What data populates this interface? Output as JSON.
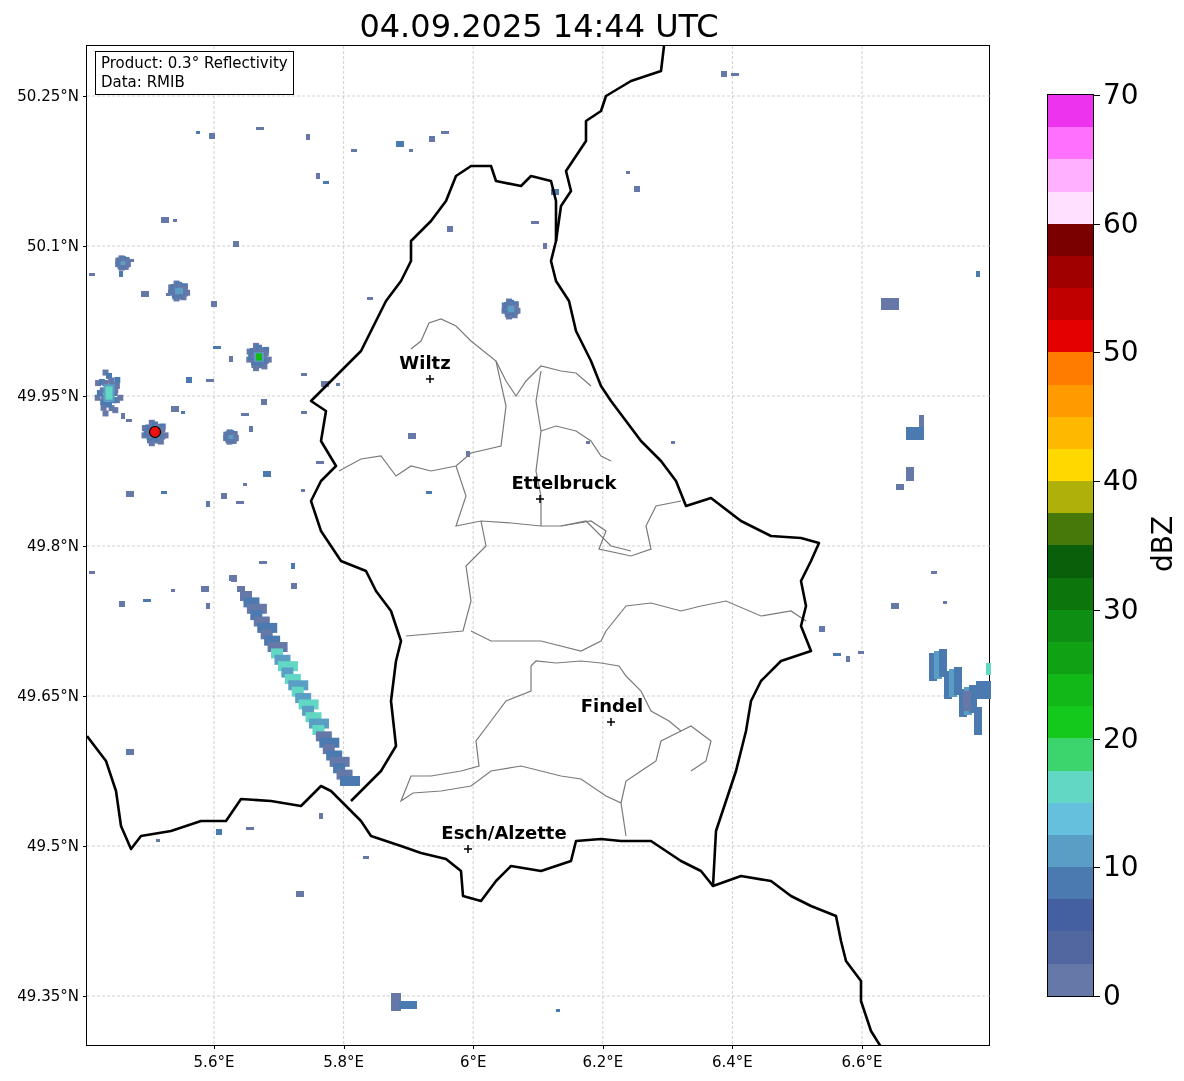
{
  "title": "04.09.2025 14:44 UTC",
  "map": {
    "info_box": [
      "Product: 0.3° Reflectivity",
      "Data: RMIB"
    ],
    "yticks": [
      "50.25°N",
      "50.1°N",
      "49.95°N",
      "49.8°N",
      "49.65°N",
      "49.5°N",
      "49.35°N"
    ],
    "xticks": [
      "5.6°E",
      "5.8°E",
      "6°E",
      "6.2°E",
      "6.4°E",
      "6.6°E"
    ],
    "cities": [
      {
        "name": "Wiltz"
      },
      {
        "name": "Ettelbruck"
      },
      {
        "name": "Findel"
      },
      {
        "name": "Esch/Alzette"
      }
    ]
  },
  "colorbar": {
    "label": "dBZ",
    "ticks": [
      "70",
      "60",
      "50",
      "40",
      "30",
      "20",
      "10",
      "0"
    ],
    "bands": [
      {
        "color": "#ee33ee"
      },
      {
        "color": "#ff70ff"
      },
      {
        "color": "#ffb0ff"
      },
      {
        "color": "#ffe0ff"
      },
      {
        "color": "#7a0000"
      },
      {
        "color": "#a00000"
      },
      {
        "color": "#c00000"
      },
      {
        "color": "#e40000"
      },
      {
        "color": "#ff7c00"
      },
      {
        "color": "#ff9a00"
      },
      {
        "color": "#ffb800"
      },
      {
        "color": "#ffd800"
      },
      {
        "color": "#b0b00a"
      },
      {
        "color": "#46780a"
      },
      {
        "color": "#0a600a"
      },
      {
        "color": "#0c760c"
      },
      {
        "color": "#0e8e12"
      },
      {
        "color": "#10a214"
      },
      {
        "color": "#12b818"
      },
      {
        "color": "#14c81c"
      },
      {
        "color": "#3cd46c"
      },
      {
        "color": "#62d8c4"
      },
      {
        "color": "#64c0dc"
      },
      {
        "color": "#5a9ec5"
      },
      {
        "color": "#4a7ab0"
      },
      {
        "color": "#4560a0"
      },
      {
        "color": "#52679f"
      },
      {
        "color": "#6678a8"
      }
    ]
  }
}
